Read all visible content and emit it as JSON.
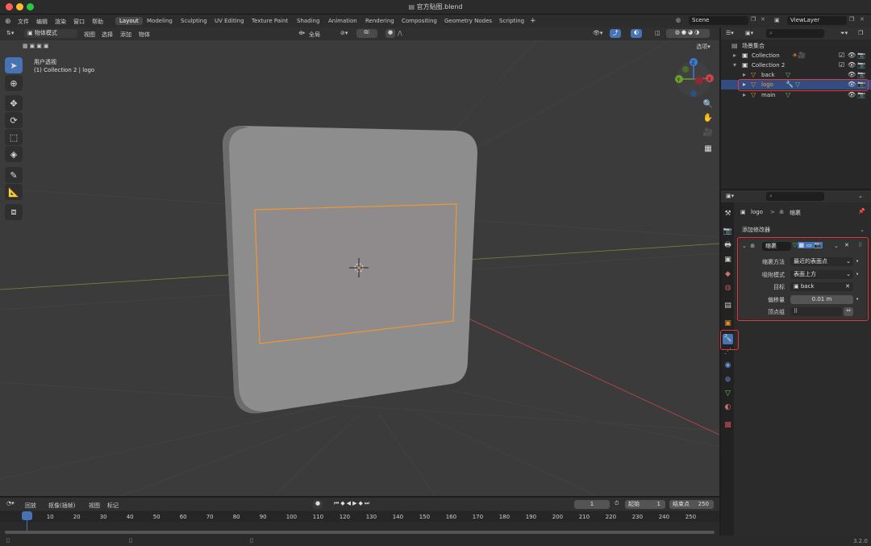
{
  "window": {
    "title": "官方贴图.blend"
  },
  "menu": [
    "文件",
    "编辑",
    "渲染",
    "窗口",
    "帮助"
  ],
  "workspaces": [
    "Layout",
    "Modeling",
    "Sculpting",
    "UV Editing",
    "Texture Paint",
    "Shading",
    "Animation",
    "Rendering",
    "Compositing",
    "Geometry Nodes",
    "Scripting"
  ],
  "active_workspace": "Layout",
  "add_tab": "+",
  "scene": {
    "value": "Scene"
  },
  "view_layer": {
    "value": "ViewLayer"
  },
  "viewport": {
    "mode": "物体模式",
    "menu": [
      "视图",
      "选择",
      "添加",
      "物体"
    ],
    "transform_orientation": "全局",
    "options_label": "选项",
    "view_name": "用户透视",
    "context_line": "(1) Collection 2 | logo",
    "gizmo_axes": {
      "x": "X",
      "y": "Y",
      "z": "Z"
    },
    "colors": {
      "background": "#3b3b3b",
      "selection": "#f0962e",
      "x_axis": "#c8464a",
      "y_axis": "#6aa02a",
      "z_axis": "#3d7ad1"
    }
  },
  "outliner": {
    "title": "场景集合",
    "rows": [
      {
        "label": "Collection",
        "indent": 1
      },
      {
        "label": "Collection 2",
        "indent": 1
      },
      {
        "label": "back",
        "indent": 2
      },
      {
        "label": "logo",
        "indent": 2,
        "selected": true
      },
      {
        "label": "main",
        "indent": 2
      }
    ]
  },
  "properties": {
    "breadcrumb_object": "logo",
    "breadcrumb_sep": ">",
    "breadcrumb_modifier": "缩裹",
    "add_modifier": "添加修改器",
    "modifier": {
      "name": "缩裹",
      "fields": [
        {
          "label": "缩裹方法",
          "value": "最近的表面点"
        },
        {
          "label": "吸附模式",
          "value": "表面上方"
        },
        {
          "label": "目标",
          "value": "back"
        },
        {
          "label": "偏移量",
          "value": "0.01 m"
        },
        {
          "label": "顶点组",
          "value": ""
        }
      ]
    }
  },
  "timeline": {
    "menu": [
      "回放",
      "抠像(插帧)",
      "视图",
      "标记"
    ],
    "current_frame": "1",
    "start_label": "起始",
    "start": "1",
    "end_label": "结束点",
    "end": "250",
    "ticks": [
      "1",
      "10",
      "20",
      "30",
      "40",
      "50",
      "60",
      "70",
      "80",
      "90",
      "100",
      "110",
      "120",
      "130",
      "140",
      "150",
      "160",
      "170",
      "180",
      "190",
      "200",
      "210",
      "220",
      "230",
      "240",
      "250"
    ]
  },
  "status": {
    "version": "3.2.0"
  }
}
